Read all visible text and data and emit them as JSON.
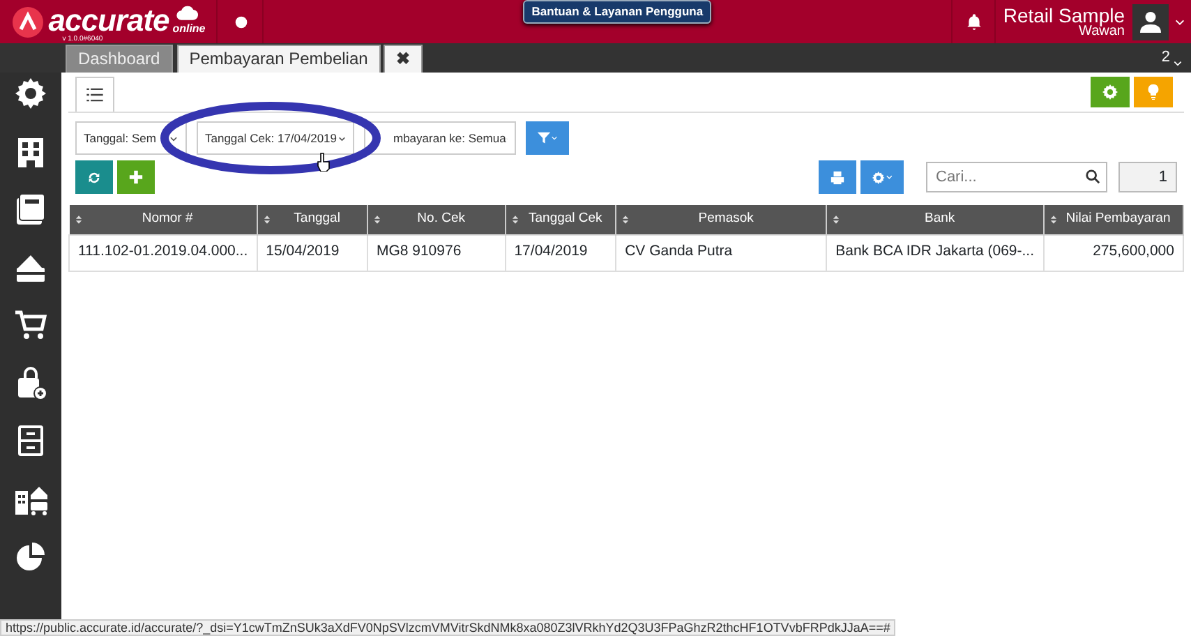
{
  "header": {
    "logo_text": "accurate",
    "logo_sub": "online",
    "version": "v 1.0.0#6040",
    "help_button": "Bantuan & Layanan Pengguna",
    "company": "Retail Sample",
    "user": "Wawan"
  },
  "tabs": [
    {
      "label": "Dashboard",
      "selected": false
    },
    {
      "label": "Pembayaran Pembelian",
      "selected": true
    }
  ],
  "tab_close": "✖",
  "tab_count": "2",
  "filters": [
    {
      "label": "Tanggal: Sem"
    },
    {
      "label": "Tanggal Cek: 17/04/2019"
    },
    {
      "label": "mbayaran ke: Semua"
    }
  ],
  "search": {
    "placeholder": "Cari..."
  },
  "page": "1",
  "table": {
    "columns": [
      "Nomor #",
      "Tanggal",
      "No. Cek",
      "Tanggal Cek",
      "Pemasok",
      "Bank",
      "Nilai Pembayaran"
    ],
    "rows": [
      [
        "111.102-01.2019.04.000...",
        "15/04/2019",
        "MG8 910976",
        "17/04/2019",
        "CV Ganda Putra",
        "Bank BCA IDR Jakarta (069-...",
        "275,600,000"
      ]
    ]
  },
  "status_bar": "https://public.accurate.id/accurate/?_dsi=Y1cwTmZnSUk3aXdFV0NpSVlzcmVMVitrSkdNMk8xa080Z3lVRkhYd2Q3U3FPaGhzR2thcHF1OTVvbFRPdkJJaA==#"
}
